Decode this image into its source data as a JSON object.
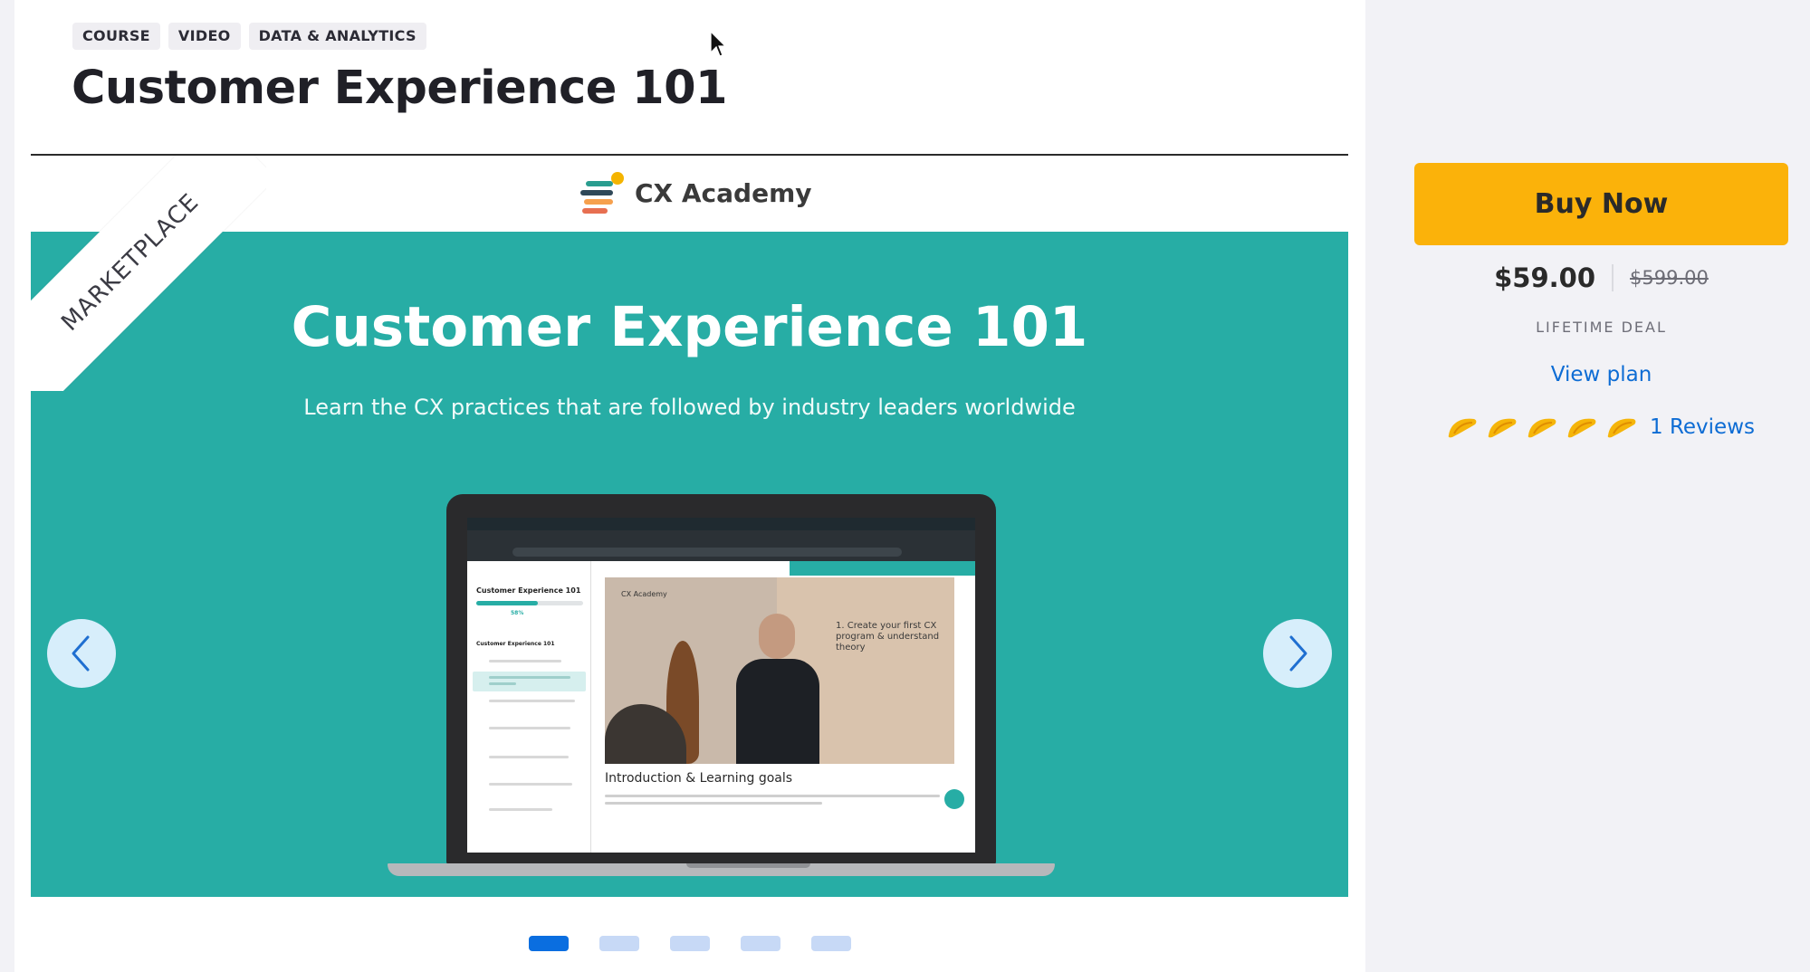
{
  "tags": [
    "COURSE",
    "VIDEO",
    "DATA & ANALYTICS"
  ],
  "title": "Customer Experience 101",
  "carousel": {
    "ribbon": "MARKETPLACE",
    "brand": "CX Academy",
    "slide_title": "Customer Experience 101",
    "slide_subtitle": "Learn the CX practices that are followed by industry leaders worldwide",
    "screen": {
      "course_title": "Customer Experience 101",
      "progress_pct": "58%",
      "sidebar_heading": "Customer Experience 101",
      "lesson_title": "Introduction & Learning goals",
      "video_text": "1. Create your first CX program & understand theory",
      "video_brand": "CX Academy",
      "progress_value": 0.58
    },
    "slide_count": 5,
    "active_slide": 1,
    "prev_icon": "chevron-left-icon",
    "next_icon": "chevron-right-icon"
  },
  "sidebar": {
    "buy_label": "Buy Now",
    "price": "$59.00",
    "old_price": "$599.00",
    "deal": "LIFETIME DEAL",
    "view_plan": "View plan",
    "rating_count": 5,
    "reviews": "1 Reviews",
    "rating_icon": "taco-icon"
  },
  "colors": {
    "accent": "#fbb20a",
    "teal": "#27ada5",
    "link": "#0d6cd4",
    "dot_active": "#0a6ee0",
    "dot_inactive": "#c7d9f6"
  }
}
